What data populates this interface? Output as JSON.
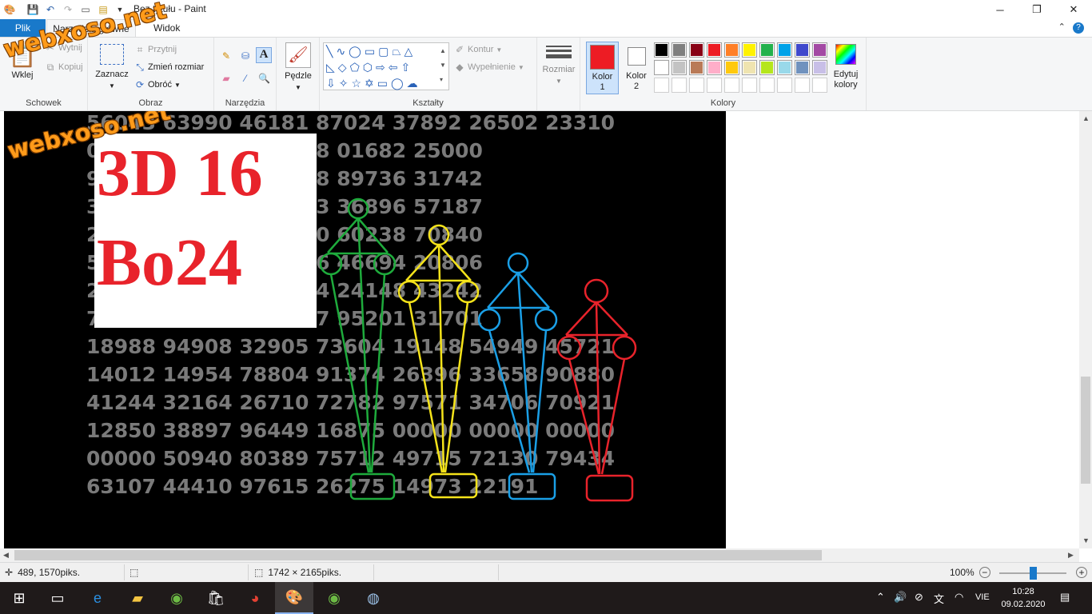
{
  "app": {
    "title": "Bez tytułu - Paint",
    "min_icon": "minimize-icon",
    "max_icon": "restore-icon",
    "close_icon": "close-icon"
  },
  "tabs": {
    "file": "Plik",
    "home": "Narzędzia główne",
    "view": "Widok"
  },
  "ribbon": {
    "clipboard": {
      "label": "Schowek",
      "paste": "Wklej",
      "cut": "Wytnij",
      "copy": "Kopiuj"
    },
    "image": {
      "label": "Obraz",
      "select": "Zaznacz",
      "crop": "Przytnij",
      "resize": "Zmień rozmiar",
      "rotate": "Obróć"
    },
    "tools": {
      "label": "Narzędzia"
    },
    "brushes": {
      "label": "Pędzle"
    },
    "shapes": {
      "label": "Kształty",
      "outline": "Kontur",
      "fill": "Wypełnienie"
    },
    "size": {
      "label": "Rozmiar"
    },
    "colors": {
      "label": "Kolory",
      "color1": "Kolor\n1",
      "color1_a": "Kolor",
      "color1_b": "1",
      "color2_a": "Kolor",
      "color2_b": "2",
      "edit_a": "Edytuj",
      "edit_b": "kolory",
      "color1_value": "#ed1c24",
      "color2_value": "#ffffff",
      "palette": [
        "#000000",
        "#7f7f7f",
        "#880015",
        "#ed1c24",
        "#ff7f27",
        "#fff200",
        "#22b14c",
        "#00a2e8",
        "#3f48cc",
        "#a349a4",
        "#ffffff",
        "#c3c3c3",
        "#b97a57",
        "#ffaec9",
        "#ffc90e",
        "#efe4b0",
        "#b5e61d",
        "#99d9ea",
        "#7092be",
        "#c8bfe7"
      ]
    }
  },
  "canvas": {
    "overlay_line1": "3D 16",
    "overlay_line2": "Bo24",
    "watermark": "webxoso.net",
    "rows": [
      "56043 63990 46181 87024 37892 26502 23310",
      "0            86358 09208 01682 25000",
      "9            15315 75178 89736 31742",
      "3            23232 40803 36896 57187",
      "2            22867 82830 60238 70840",
      "5            02447 30476 46694 20806",
      "2            46081 76684 24148 43242",
      "7            05939 04477 95201 31701",
      "18988 94908 32905 73604 19148 54949 45721",
      "14012 14954 78804 91374 26396 33658 90880",
      "41244 32164 26710 72782 97571 34706 70921",
      "12850 38897 96449 16875 00000 00000 00000",
      "00000 50940 80389 75712 49715 72130 79434",
      "63107 44410 97615 26275 14973 22191"
    ]
  },
  "status": {
    "cursor_pos": "489, 1570piks.",
    "image_size": "1742 × 2165piks.",
    "zoom": "100%"
  },
  "taskbar": {
    "time": "10:28",
    "date": "09.02.2020",
    "lang": "VIE"
  }
}
